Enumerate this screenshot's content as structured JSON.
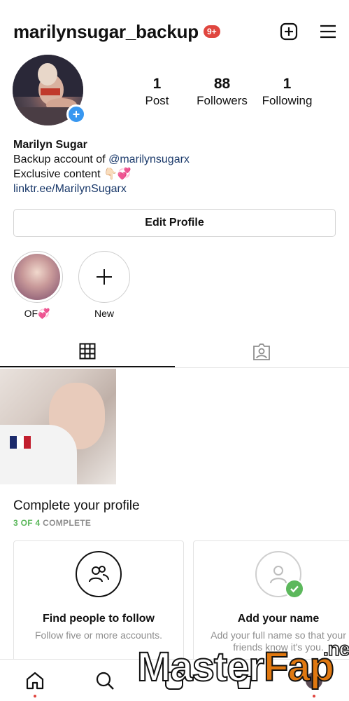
{
  "header": {
    "username": "marilynsugar_backup",
    "notif_badge": "9+",
    "icons": [
      "plus-square-icon",
      "menu-icon"
    ]
  },
  "profile": {
    "stats": [
      {
        "num": "1",
        "label": "Post"
      },
      {
        "num": "88",
        "label": "Followers"
      },
      {
        "num": "1",
        "label": "Following"
      }
    ]
  },
  "bio": {
    "name": "Marilyn Sugar",
    "line1_prefix": "Backup account of ",
    "line1_mention": "@marilynsugarx",
    "line2": "Exclusive content 👇🏻💞",
    "link": "linktr.ee/MarilynSugarx"
  },
  "edit_profile_label": "Edit Profile",
  "highlights": [
    {
      "label": "OF💞"
    },
    {
      "label": "New"
    }
  ],
  "tabs": [
    "grid-icon",
    "tagged-icon"
  ],
  "complete_profile": {
    "title": "Complete your profile",
    "progress": "3 OF 4",
    "progress_word": " COMPLETE",
    "cards": [
      {
        "title": "Find people to follow",
        "desc": "Follow five or more accounts."
      },
      {
        "title": "Add your name",
        "desc": "Add your full name so that your friends know it's you."
      }
    ]
  },
  "bottom_nav": [
    "home-icon",
    "search-icon",
    "reels-icon",
    "shop-icon",
    "profile-icon"
  ],
  "watermark": {
    "part1": "Master",
    "part2": "Fap",
    "net": ".net"
  },
  "colors": {
    "accent_blue": "#3897f0",
    "badge_red": "#e0463f",
    "complete_green": "#5cb85c",
    "link_blue": "#1b3a6b"
  }
}
